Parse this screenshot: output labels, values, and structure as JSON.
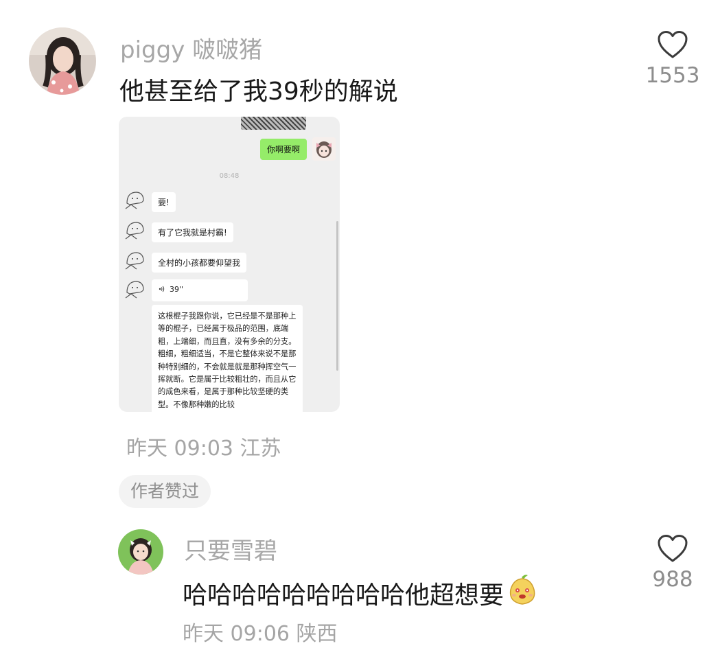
{
  "comments": [
    {
      "username": "piggy 啵啵猪",
      "text": "他甚至给了我39秒的解说",
      "time_location": "昨天 09:03 江苏",
      "likes": "1553",
      "badge": "作者赞过",
      "attachment": {
        "my_message": "你啊要啊",
        "timestamp": "08:48",
        "their_messages": [
          "要!",
          "有了它我就是村霸!",
          "全村的小孩都要仰望我"
        ],
        "voice_duration": "39''",
        "transcript": "这根棍子我跟你说，它已经是不是那种上等的棍子，已经属于极品的范围，底端粗，上端细，而且直，没有多余的分支。粗细，粗细适当，不是它整体来说不是那种特别细的，不会就是就是那种挥空气一挥就断。它是属于比较粗壮的，而且从它的成色来看，是属于那种比较坚硬的类型。不像那种嫩的比较"
      }
    },
    {
      "username": "只要雪碧",
      "text": "哈哈哈哈哈哈哈哈哈他超想要",
      "time_location": "昨天 09:06 陕西",
      "likes": "988",
      "emoji": "pear-face-emoji"
    }
  ],
  "icons": {
    "like": "heart-outline-icon"
  },
  "colors": {
    "username": "#a7a7a7",
    "meta": "#a5a5a5",
    "chat_green": "#95ec69",
    "chat_bg": "#efefef"
  }
}
